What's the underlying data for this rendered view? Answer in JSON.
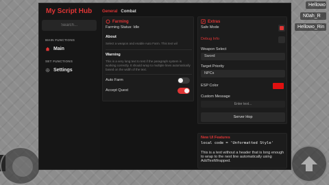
{
  "background": {
    "player_tags": [
      "Hellowo",
      "N0ah_R",
      "Hellowo_Rin"
    ]
  },
  "sidebar": {
    "title": "My Script Hub",
    "search_placeholder": "Search...",
    "sections": [
      {
        "header": "MAIN FUNCTIONS",
        "item": {
          "label": "Main",
          "icon": "home-icon"
        }
      },
      {
        "header": "SET FUNCTIONS",
        "item": {
          "label": "Settings",
          "icon": "gear-icon"
        }
      }
    ]
  },
  "tabs": [
    {
      "label": "General",
      "active": true
    },
    {
      "label": "Combat",
      "active": false
    }
  ],
  "farming": {
    "title": "Farming",
    "status": "Farming Status: Idle",
    "about_heading": "About",
    "about_text": "Select a weapon and enable Auto Farm. This text wil",
    "warning_heading": "Warning",
    "warning_text": "This is a very long text to test if the paragraph system is working correctly. It should wrap to multiple lines automatically based on the width of the text.",
    "auto_farm_label": "Auto Farm",
    "auto_farm_on": false,
    "accept_quest_label": "Accept Quest",
    "accept_quest_on": true
  },
  "extras": {
    "title": "Extras",
    "safe_mode_label": "Safe Mode",
    "safe_mode_checked": true,
    "debug_label": "Debug Info",
    "debug_checked": false,
    "weapon_label": "Weapon Select",
    "weapon_value": "Sword",
    "target_label": "Target Priority",
    "target_value": "NPCs",
    "esp_label": "ESP Color",
    "esp_color": "#e01010",
    "custom_msg_label": "Custom Message",
    "custom_msg_placeholder": "Enter text...",
    "server_hop_label": "Server Hop"
  },
  "new_features": {
    "title": "New UI Features",
    "code_line": "local code = 'Unformatted Style'",
    "body": "This is a text without a header that is long enough to wrap to the next line automatically using AddTextWrapped."
  },
  "colors": {
    "accent": "#e03535",
    "window_bg": "#141414",
    "panel_bg": "#1c1c1c"
  }
}
